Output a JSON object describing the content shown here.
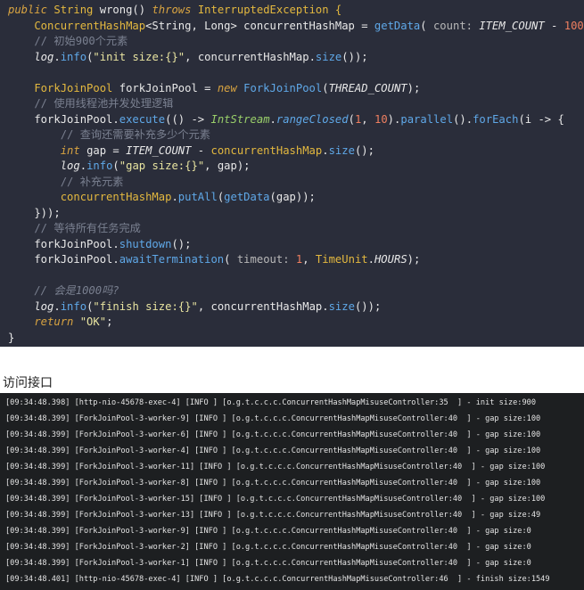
{
  "colors": {
    "keyword": "#d9a441",
    "type": "#e3b83f",
    "method": "#5fa8e8",
    "string": "#e8e4a0",
    "number": "#ef7f60",
    "comment": "#7a8090",
    "constant": "#e8e8e8",
    "hint": "#b8b8b8",
    "plain": "#e8e8e8",
    "green": "#9ad06a"
  },
  "code_lines": [
    [
      [
        "public ",
        "keyword",
        "i"
      ],
      [
        "String ",
        "type",
        ""
      ],
      [
        "wrong() ",
        "plain",
        ""
      ],
      [
        "throws ",
        "keyword",
        "i"
      ],
      [
        "InterruptedException {",
        "type",
        ""
      ]
    ],
    [
      [
        "    ConcurrentHashMap",
        "type",
        ""
      ],
      [
        "<String, Long> concurrentHashMap = ",
        "plain",
        ""
      ],
      [
        "getData",
        "method",
        ""
      ],
      [
        "( ",
        "plain",
        ""
      ],
      [
        "count: ",
        "hint",
        ""
      ],
      [
        "ITEM_COUNT",
        "constant",
        "i"
      ],
      [
        " - ",
        "plain",
        ""
      ],
      [
        "100",
        "number",
        ""
      ],
      [
        ");",
        "plain",
        ""
      ]
    ],
    [
      [
        "    // 初始900个元素",
        "comment",
        ""
      ]
    ],
    [
      [
        "    log",
        "plain",
        "i"
      ],
      [
        ".",
        "plain",
        ""
      ],
      [
        "info",
        "method",
        ""
      ],
      [
        "(",
        "plain",
        ""
      ],
      [
        "\"init size:{}\"",
        "string",
        ""
      ],
      [
        ", concurrentHashMap.",
        "plain",
        ""
      ],
      [
        "size",
        "method",
        ""
      ],
      [
        "());",
        "plain",
        ""
      ]
    ],
    [
      [
        "",
        "plain",
        ""
      ]
    ],
    [
      [
        "    ForkJoinPool ",
        "type",
        ""
      ],
      [
        "forkJoinPool = ",
        "plain",
        ""
      ],
      [
        "new ",
        "keyword",
        "i"
      ],
      [
        "ForkJoinPool",
        "method",
        ""
      ],
      [
        "(",
        "plain",
        ""
      ],
      [
        "THREAD_COUNT",
        "constant",
        "i"
      ],
      [
        ");",
        "plain",
        ""
      ]
    ],
    [
      [
        "    // 使用线程池并发处理逻辑",
        "comment",
        ""
      ]
    ],
    [
      [
        "    forkJoinPool.",
        "plain",
        ""
      ],
      [
        "execute",
        "method",
        ""
      ],
      [
        "(() -> ",
        "plain",
        ""
      ],
      [
        "IntStream",
        "green",
        "i"
      ],
      [
        ".",
        "plain",
        ""
      ],
      [
        "rangeClosed",
        "method",
        "i"
      ],
      [
        "(",
        "plain",
        ""
      ],
      [
        "1",
        "number",
        ""
      ],
      [
        ", ",
        "plain",
        ""
      ],
      [
        "10",
        "number",
        ""
      ],
      [
        ").",
        "plain",
        ""
      ],
      [
        "parallel",
        "method",
        ""
      ],
      [
        "().",
        "plain",
        ""
      ],
      [
        "forEach",
        "method",
        ""
      ],
      [
        "(i -> {",
        "plain",
        ""
      ]
    ],
    [
      [
        "        // 查询还需要补充多少个元素",
        "comment",
        ""
      ]
    ],
    [
      [
        "        int ",
        "keyword",
        "i"
      ],
      [
        "gap = ",
        "plain",
        ""
      ],
      [
        "ITEM_COUNT",
        "constant",
        "i"
      ],
      [
        " - ",
        "plain",
        ""
      ],
      [
        "concurrentHashMap",
        "type",
        ""
      ],
      [
        ".",
        "plain",
        ""
      ],
      [
        "size",
        "method",
        ""
      ],
      [
        "();",
        "plain",
        ""
      ]
    ],
    [
      [
        "        log",
        "plain",
        "i"
      ],
      [
        ".",
        "plain",
        ""
      ],
      [
        "info",
        "method",
        ""
      ],
      [
        "(",
        "plain",
        ""
      ],
      [
        "\"gap size:{}\"",
        "string",
        ""
      ],
      [
        ", gap);",
        "plain",
        ""
      ]
    ],
    [
      [
        "        // 补充元素",
        "comment",
        ""
      ]
    ],
    [
      [
        "        concurrentHashMap",
        "type",
        ""
      ],
      [
        ".",
        "plain",
        ""
      ],
      [
        "putAll",
        "method",
        ""
      ],
      [
        "(",
        "plain",
        ""
      ],
      [
        "getData",
        "method",
        ""
      ],
      [
        "(gap));",
        "plain",
        ""
      ]
    ],
    [
      [
        "    }));",
        "plain",
        ""
      ]
    ],
    [
      [
        "    // 等待所有任务完成",
        "comment",
        ""
      ]
    ],
    [
      [
        "    forkJoinPool.",
        "plain",
        ""
      ],
      [
        "shutdown",
        "method",
        ""
      ],
      [
        "();",
        "plain",
        ""
      ]
    ],
    [
      [
        "    forkJoinPool.",
        "plain",
        ""
      ],
      [
        "awaitTermination",
        "method",
        ""
      ],
      [
        "( ",
        "plain",
        ""
      ],
      [
        "timeout: ",
        "hint",
        ""
      ],
      [
        "1",
        "number",
        ""
      ],
      [
        ", ",
        "plain",
        ""
      ],
      [
        "TimeUnit",
        "type",
        ""
      ],
      [
        ".",
        "plain",
        ""
      ],
      [
        "HOURS",
        "constant",
        "i"
      ],
      [
        ");",
        "plain",
        ""
      ]
    ],
    [
      [
        "",
        "plain",
        ""
      ]
    ],
    [
      [
        "    // 会是1000吗?",
        "comment",
        "i"
      ]
    ],
    [
      [
        "    log",
        "plain",
        "i"
      ],
      [
        ".",
        "plain",
        ""
      ],
      [
        "info",
        "method",
        ""
      ],
      [
        "(",
        "plain",
        ""
      ],
      [
        "\"finish size:{}\"",
        "string",
        ""
      ],
      [
        ", concurrentHashMap.",
        "plain",
        ""
      ],
      [
        "size",
        "method",
        ""
      ],
      [
        "());",
        "plain",
        ""
      ]
    ],
    [
      [
        "    return ",
        "keyword",
        "i"
      ],
      [
        "\"OK\"",
        "string",
        ""
      ],
      [
        ";",
        "plain",
        ""
      ]
    ],
    [
      [
        "}",
        "plain",
        ""
      ]
    ]
  ],
  "section_label": "访问接口",
  "log_lines": [
    "[09:34:48.398] [http-nio-45678-exec-4] [INFO ] [o.g.t.c.c.c.ConcurrentHashMapMisuseController:35  ] - init size:900",
    "[09:34:48.399] [ForkJoinPool-3-worker-9] [INFO ] [o.g.t.c.c.c.ConcurrentHashMapMisuseController:40  ] - gap size:100",
    "[09:34:48.399] [ForkJoinPool-3-worker-6] [INFO ] [o.g.t.c.c.c.ConcurrentHashMapMisuseController:40  ] - gap size:100",
    "[09:34:48.399] [ForkJoinPool-3-worker-4] [INFO ] [o.g.t.c.c.c.ConcurrentHashMapMisuseController:40  ] - gap size:100",
    "[09:34:48.399] [ForkJoinPool-3-worker-11] [INFO ] [o.g.t.c.c.c.ConcurrentHashMapMisuseController:40  ] - gap size:100",
    "[09:34:48.399] [ForkJoinPool-3-worker-8] [INFO ] [o.g.t.c.c.c.ConcurrentHashMapMisuseController:40  ] - gap size:100",
    "[09:34:48.399] [ForkJoinPool-3-worker-15] [INFO ] [o.g.t.c.c.c.ConcurrentHashMapMisuseController:40  ] - gap size:100",
    "[09:34:48.399] [ForkJoinPool-3-worker-13] [INFO ] [o.g.t.c.c.c.ConcurrentHashMapMisuseController:40  ] - gap size:49",
    "[09:34:48.399] [ForkJoinPool-3-worker-9] [INFO ] [o.g.t.c.c.c.ConcurrentHashMapMisuseController:40  ] - gap size:0",
    "[09:34:48.399] [ForkJoinPool-3-worker-2] [INFO ] [o.g.t.c.c.c.ConcurrentHashMapMisuseController:40  ] - gap size:0",
    "[09:34:48.399] [ForkJoinPool-3-worker-1] [INFO ] [o.g.t.c.c.c.ConcurrentHashMapMisuseController:40  ] - gap size:0",
    "[09:34:48.401] [http-nio-45678-exec-4] [INFO ] [o.g.t.c.c.c.ConcurrentHashMapMisuseController:46  ] - finish size:1549"
  ]
}
